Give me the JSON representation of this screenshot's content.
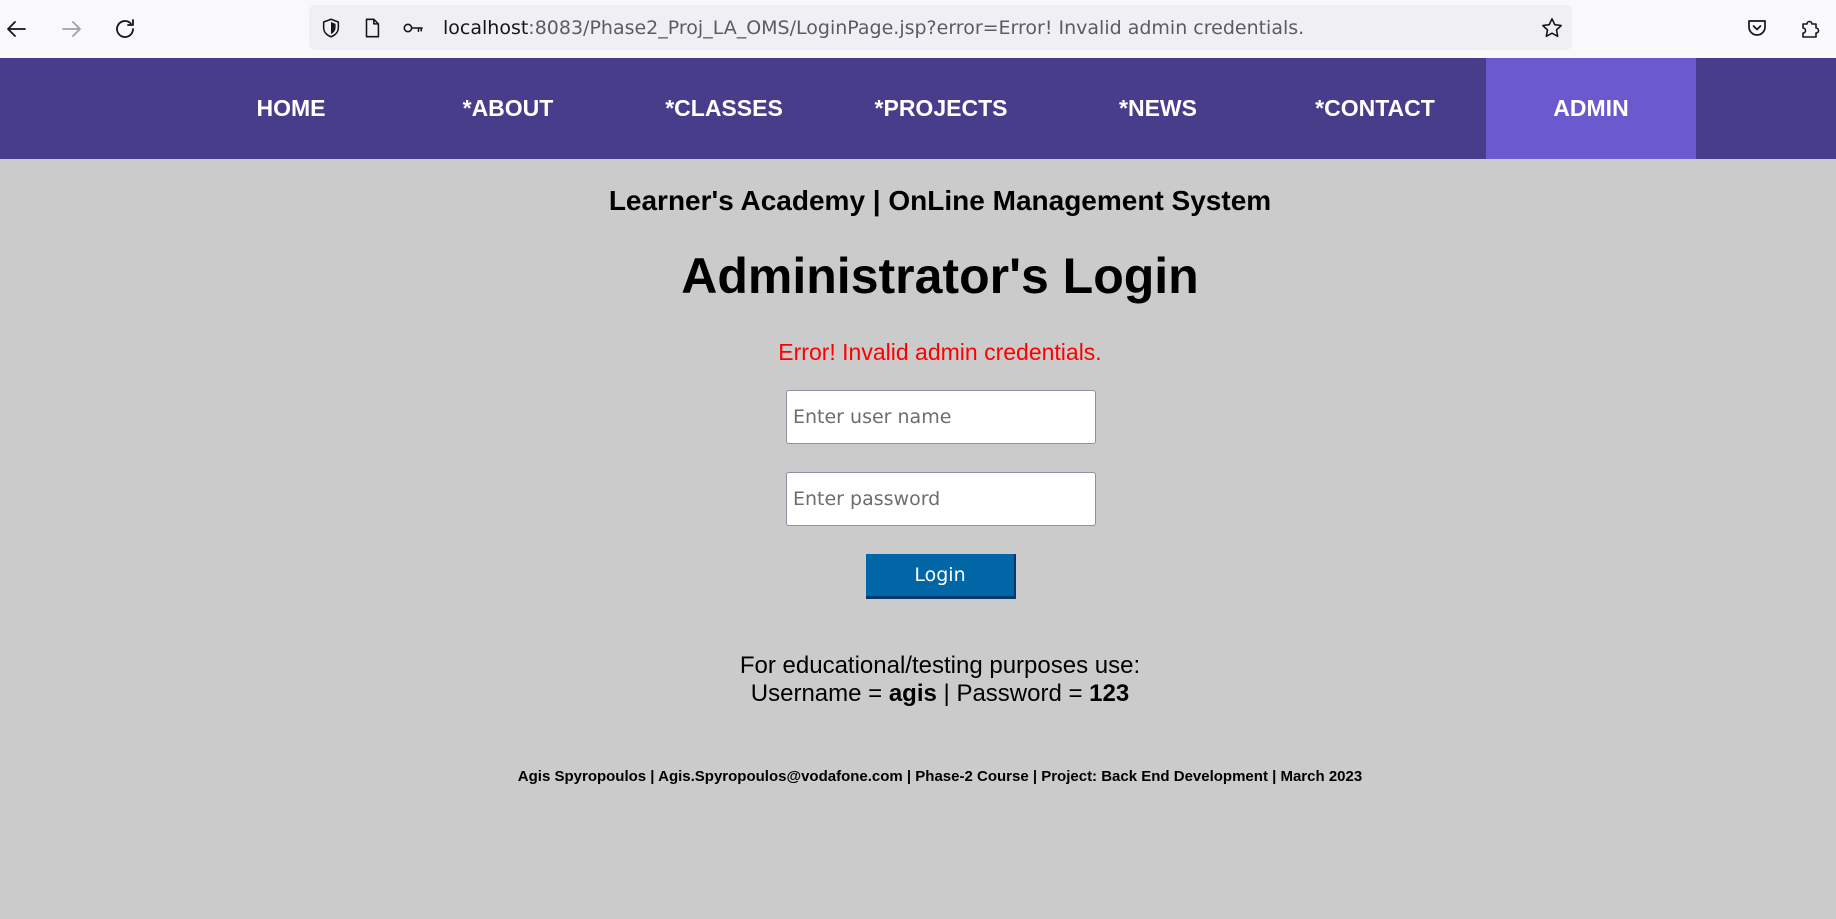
{
  "browser": {
    "url_host": "localhost",
    "url_rest": ":8083/Phase2_Proj_LA_OMS/LoginPage.jsp?error=Error! Invalid admin credentials.",
    "icons": {
      "back": "back-arrow-icon",
      "forward": "forward-arrow-icon",
      "reload": "reload-icon",
      "shield": "shield-icon",
      "page": "page-icon",
      "key": "key-icon",
      "bookmark": "star-icon",
      "pocket": "pocket-icon",
      "extensions": "puzzle-icon"
    }
  },
  "nav": {
    "items": [
      {
        "label": "HOME"
      },
      {
        "label": "*ABOUT"
      },
      {
        "label": "*CLASSES"
      },
      {
        "label": "*PROJECTS"
      },
      {
        "label": "*NEWS"
      },
      {
        "label": "*CONTACT"
      },
      {
        "label": "ADMIN",
        "active": true
      }
    ],
    "colors": {
      "background": "#483d8b",
      "active": "#6a5acd",
      "text": "#ffffff"
    }
  },
  "main": {
    "site_title": "Learner's Academy | OnLine Management System",
    "heading": "Administrator's Login",
    "error": "Error! Invalid admin credentials.",
    "form": {
      "username_placeholder": "Enter user name",
      "password_placeholder": "Enter password",
      "username_value": "",
      "password_value": "",
      "submit_label": "Login"
    },
    "hint": {
      "line1": "For educational/testing purposes use:",
      "username_label": "Username = ",
      "username_value": "agis",
      "separator": " | ",
      "password_label": "Password = ",
      "password_value": "123"
    },
    "footer": "Agis Spyropoulos | Agis.Spyropoulos@vodafone.com | Phase-2 Course | Project: Back End Development | March 2023"
  },
  "colors": {
    "page_background": "#cbcbcb",
    "error": "#ff0000",
    "button": "#0066a6"
  }
}
